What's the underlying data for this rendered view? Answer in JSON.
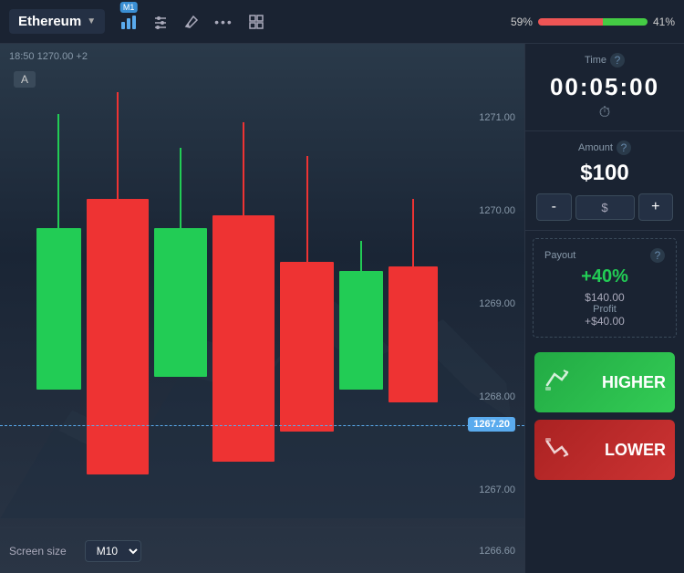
{
  "header": {
    "asset": "Ethereum",
    "asset_arrow": "▼",
    "m1_badge": "M1",
    "progress_left_pct": 59,
    "progress_right_pct": 41,
    "progress_left_label": "59%",
    "progress_right_label": "41%"
  },
  "chart": {
    "top_info": "18:50 1270.00 +2",
    "point_a": "A",
    "prices": [
      "1271.00",
      "1270.00",
      "1269.00",
      "1268.00",
      "1267.20",
      "1267.00",
      "1266.60"
    ],
    "current_price": "1267.20",
    "bottom_price": "1266.60"
  },
  "footer": {
    "screen_size_label": "Screen size",
    "screen_size_value": "M10",
    "screen_size_arrow": "▼"
  },
  "sidebar": {
    "time_label": "Time",
    "time_value": "00:05:00",
    "amount_label": "Amount",
    "amount_value": "$100",
    "amount_currency": "$",
    "amount_minus": "-",
    "amount_plus": "+",
    "payout_label": "Payout",
    "payout_percent": "+40%",
    "payout_amount": "$140.00",
    "profit_label": "Profit",
    "profit_amount": "+$40.00",
    "higher_label": "HIGHER",
    "lower_label": "LOWER"
  }
}
